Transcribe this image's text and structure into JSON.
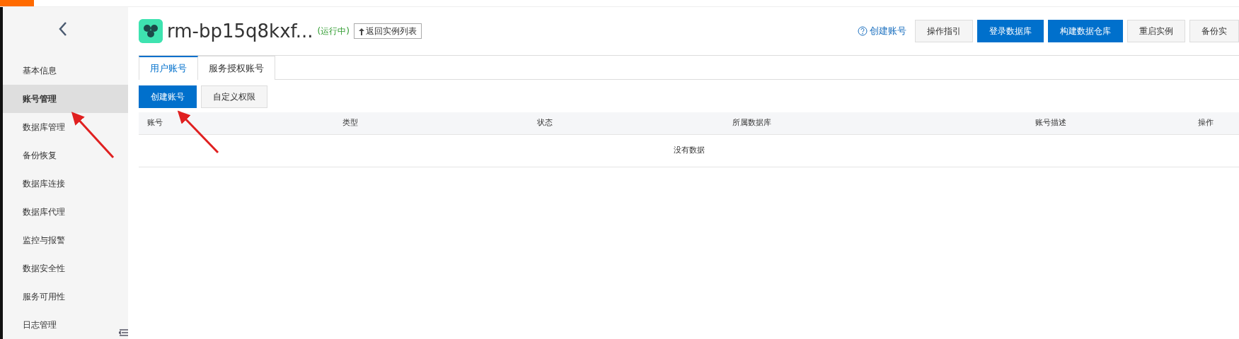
{
  "sidebar": {
    "items": [
      {
        "label": "基本信息",
        "selected": false
      },
      {
        "label": "账号管理",
        "selected": true
      },
      {
        "label": "数据库管理",
        "selected": false
      },
      {
        "label": "备份恢复",
        "selected": false
      },
      {
        "label": "数据库连接",
        "selected": false
      },
      {
        "label": "数据库代理",
        "selected": false
      },
      {
        "label": "监控与报警",
        "selected": false
      },
      {
        "label": "数据安全性",
        "selected": false
      },
      {
        "label": "服务可用性",
        "selected": false
      },
      {
        "label": "日志管理",
        "selected": false
      }
    ]
  },
  "header": {
    "title": "rm-bp15q8kxf...",
    "status": "(运行中)",
    "back_button": "返回实例列表",
    "help_link": "创建账号",
    "buttons": [
      {
        "label": "操作指引",
        "kind": "default"
      },
      {
        "label": "登录数据库",
        "kind": "primary"
      },
      {
        "label": "构建数据仓库",
        "kind": "primary"
      },
      {
        "label": "重启实例",
        "kind": "default"
      },
      {
        "label": "备份实",
        "kind": "default"
      }
    ]
  },
  "tabs": [
    {
      "label": "用户账号",
      "selected": true
    },
    {
      "label": "服务授权账号",
      "selected": false
    }
  ],
  "toolbar": [
    {
      "label": "创建账号",
      "kind": "primary"
    },
    {
      "label": "自定义权限",
      "kind": "default"
    }
  ],
  "table": {
    "columns": [
      "账号",
      "类型",
      "状态",
      "所属数据库",
      "账号描述",
      "操作"
    ],
    "empty_text": "没有数据"
  }
}
